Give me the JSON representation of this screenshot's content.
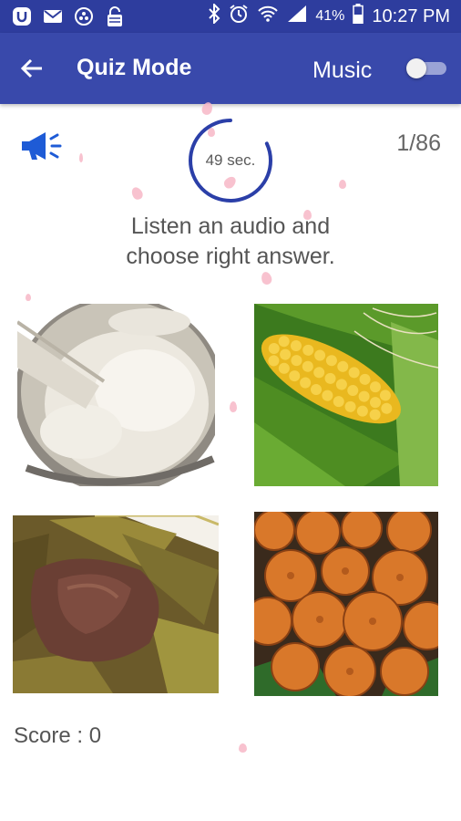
{
  "status_bar": {
    "battery_percent": "41%",
    "time": "10:27 PM",
    "icons": [
      "u-app-icon",
      "mail-icon",
      "circle-app-icon",
      "lock-icon",
      "bluetooth-icon",
      "alarm-icon",
      "wifi-icon",
      "signal-icon",
      "battery-icon"
    ]
  },
  "app_bar": {
    "back_icon": "arrow-back-icon",
    "title": "Quiz Mode",
    "music_label": "Music",
    "music_enabled": false
  },
  "quiz": {
    "speaker_icon": "megaphone-icon",
    "timer_text": "49 sec.",
    "timer_fraction_remaining": 0.82,
    "progress": "1/86",
    "instruction_line1": "Listen an audio and",
    "instruction_line2": "choose right answer.",
    "options": [
      {
        "image": "pounded-yam-photo"
      },
      {
        "image": "corn-cob-photo"
      },
      {
        "image": "wrapped-meat-leaves-photo"
      },
      {
        "image": "palm-fruit-photo"
      }
    ],
    "score_text": "Score : 0"
  },
  "colors": {
    "status_bar": "#2e3d9e",
    "app_bar": "#3949ab",
    "accent_blue": "#1e5bd6",
    "timer_ring": "#2b3fa8",
    "petal": "#f7b7c7"
  }
}
